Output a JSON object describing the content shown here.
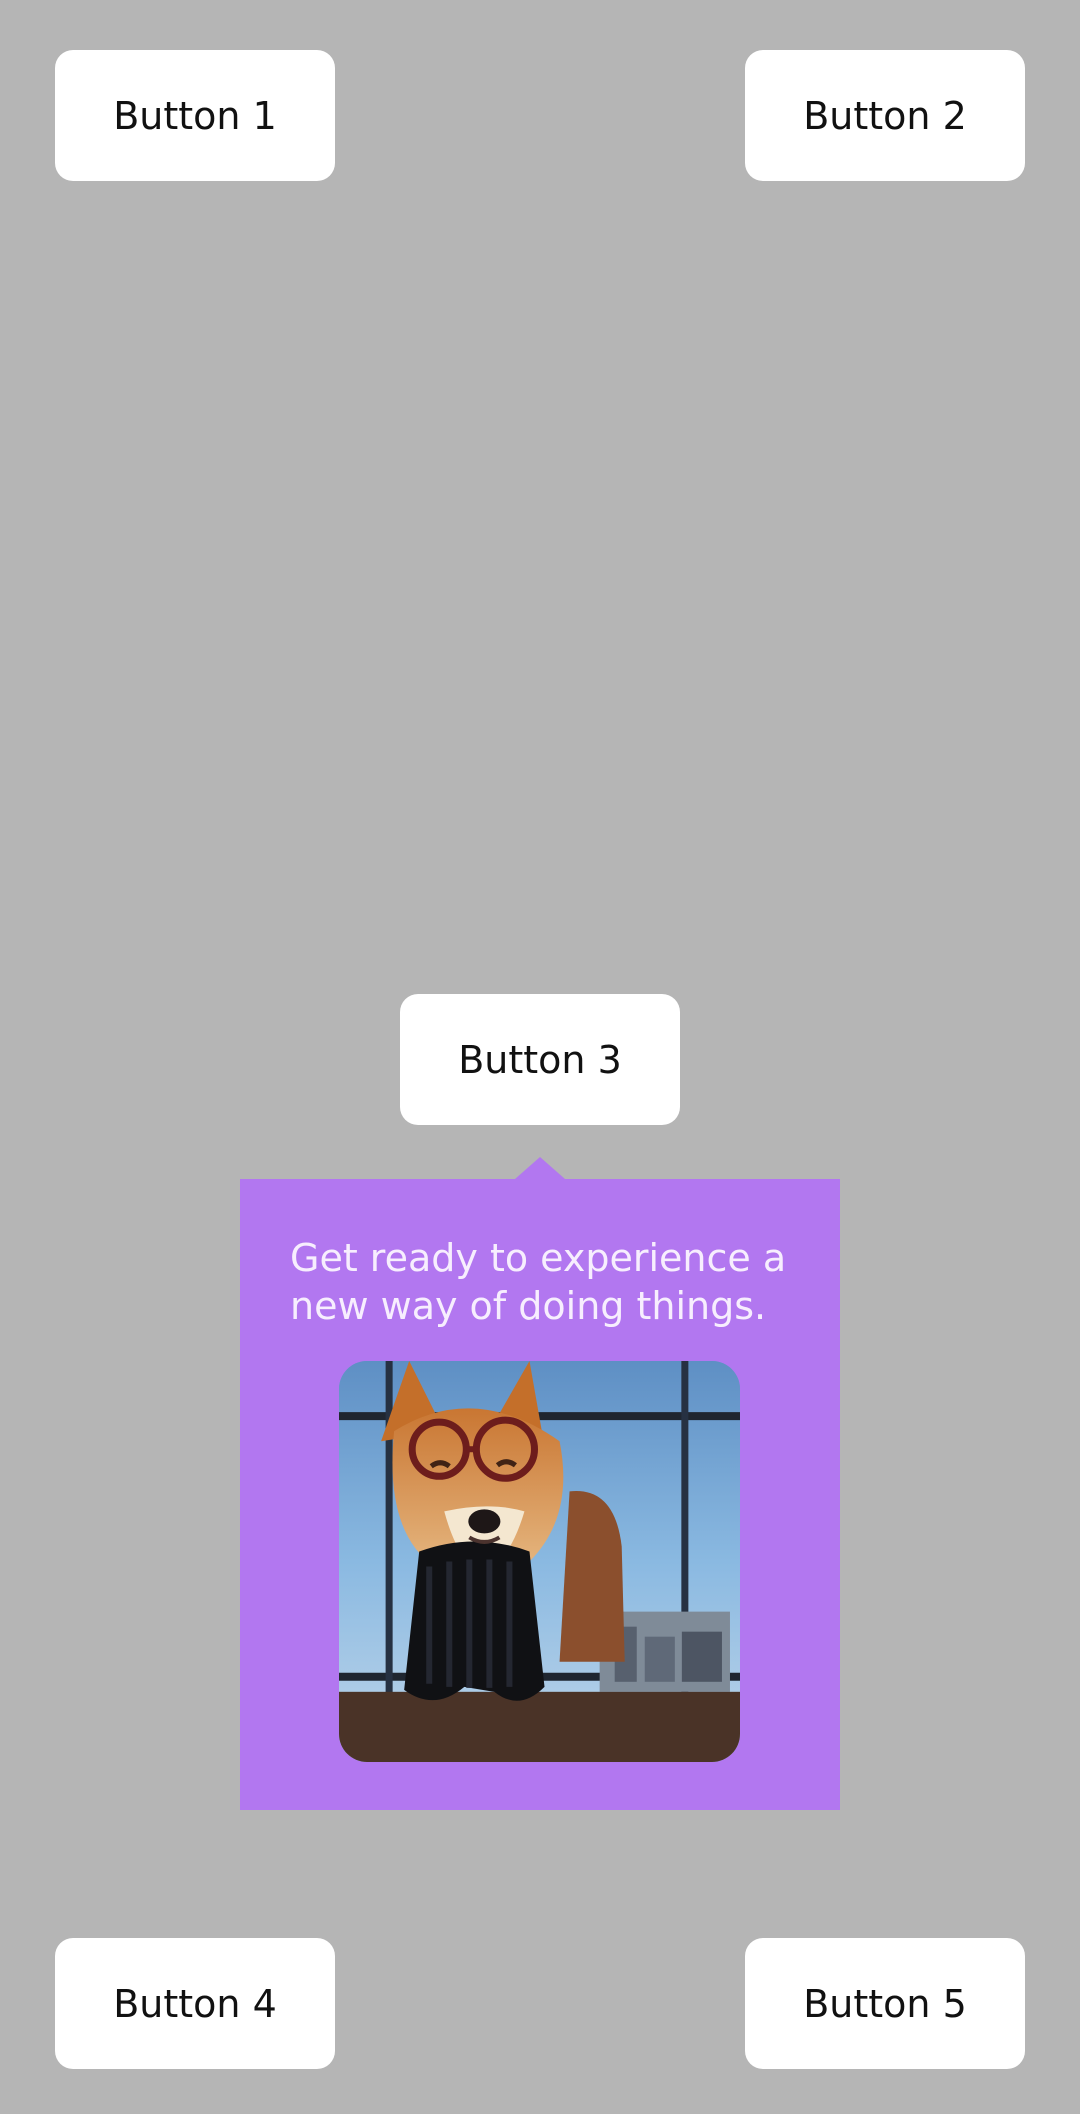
{
  "buttons": {
    "b1": "Button 1",
    "b2": "Button 2",
    "b3": "Button 3",
    "b4": "Button 4",
    "b5": "Button 5"
  },
  "tooltip": {
    "line1": "Get ready to experience a",
    "line2": "new way of doing things.",
    "image_icon": "dog-with-glasses-photo"
  },
  "colors": {
    "background": "#b5b5b5",
    "button": "#ffffff",
    "tooltip": "#b277f0",
    "tooltip_text": "#f7eefe"
  }
}
